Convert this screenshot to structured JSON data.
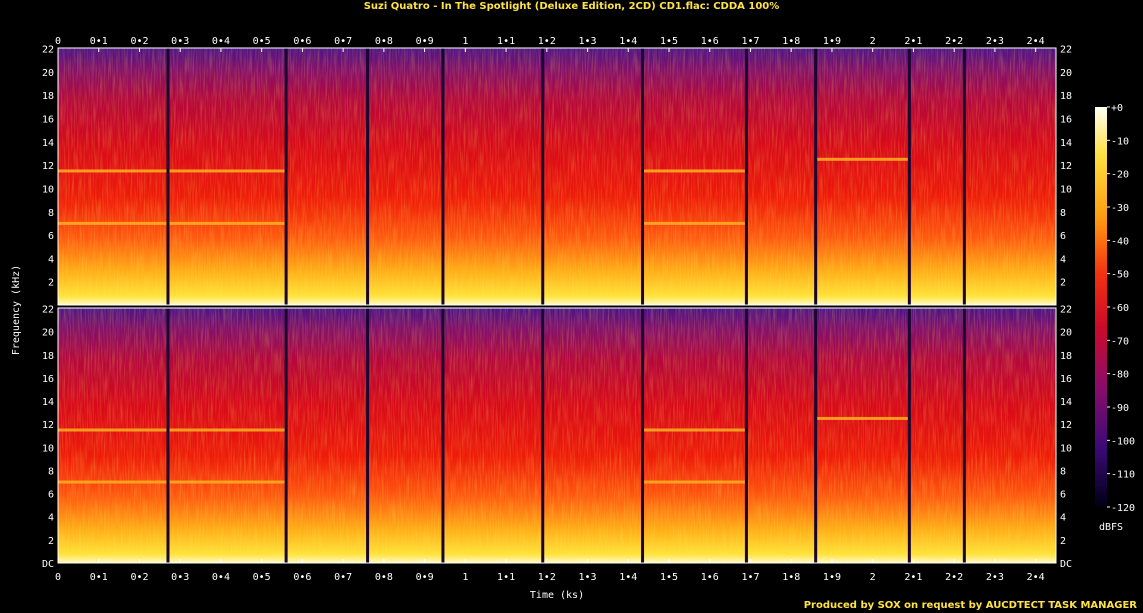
{
  "title": "Suzi Quatro - In The Spotlight (Deluxe Edition, 2CD) CD1.flac: CDDA 100%",
  "footer": "Produced by SOX on request by AUCDTECT TASK MANAGER",
  "colors": {
    "title": "#ffe24a",
    "background": "#000000",
    "frame": "#ffffff"
  },
  "chart_data": {
    "type": "heatmap",
    "title": "Suzi Quatro - In The Spotlight (Deluxe Edition, 2CD) CD1.flac: CDDA 100%",
    "xlabel": "Time (ks)",
    "ylabel": "Frequency (kHz)",
    "colorbar_label": "dBFS",
    "xlim": [
      0,
      2.45
    ],
    "ylim": [
      0,
      22.05
    ],
    "channels": 2,
    "x_ticks": [
      "0",
      "0•1",
      "0•2",
      "0•3",
      "0•4",
      "0•5",
      "0•6",
      "0•7",
      "0•8",
      "0•9",
      "1",
      "1•1",
      "1•2",
      "1•3",
      "1•4",
      "1•5",
      "1•6",
      "1•7",
      "1•8",
      "1•9",
      "2",
      "2•1",
      "2•2",
      "2•3",
      "2•4"
    ],
    "y_ticks": [
      "DC",
      "2",
      "4",
      "6",
      "8",
      "10",
      "12",
      "14",
      "16",
      "18",
      "20",
      "22"
    ],
    "colorbar_ticks": [
      "+0",
      "-10",
      "-20",
      "-30",
      "-40",
      "-50",
      "-60",
      "-70",
      "-80",
      "-90",
      "-100",
      "-110",
      "-120"
    ],
    "track_boundaries_ks": [
      0.27,
      0.56,
      0.76,
      0.945,
      1.19,
      1.435,
      1.69,
      1.86,
      2.09,
      2.225
    ],
    "tonal_lines_khz": [
      {
        "x_range": [
          0.0,
          0.56
        ],
        "freqs": [
          7.0,
          11.5
        ]
      },
      {
        "x_range": [
          1.435,
          1.69
        ],
        "freqs": [
          7.0,
          11.5
        ]
      },
      {
        "x_range": [
          1.86,
          2.09
        ],
        "freqs": [
          12.5
        ]
      }
    ]
  }
}
